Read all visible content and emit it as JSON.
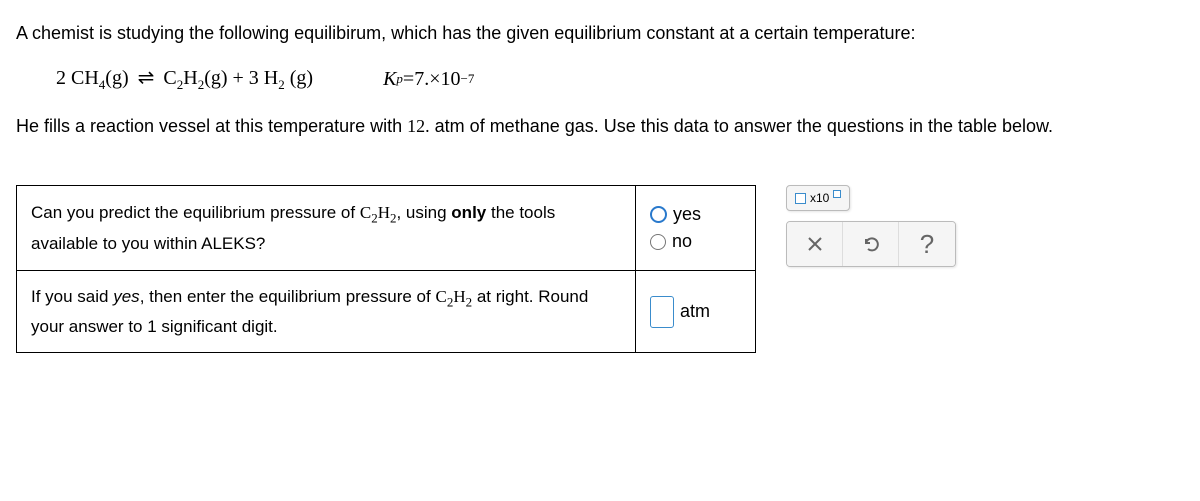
{
  "intro": "A chemist is studying the following equilibirum, which has the given equilibrium constant at a certain temperature:",
  "equation": {
    "lhs_coeff": "2",
    "lhs_species": "CH",
    "lhs_sub": "4",
    "lhs_phase": "(g)",
    "rhs1_species": "C",
    "rhs1_sub1": "2",
    "rhs1_species2": "H",
    "rhs1_sub2": "2",
    "rhs1_phase": "(g)",
    "plus": " + ",
    "rhs2_coeff": "3",
    "rhs2_species": "H",
    "rhs2_sub": "2",
    "rhs2_phase": "(g)"
  },
  "kp": {
    "label": "K",
    "sub": "p",
    "eq": "=",
    "mantissa": "7.",
    "times": " × ",
    "base": "10",
    "exp": "−7"
  },
  "secondary": {
    "pre": "He fills a reaction vessel at this temperature with ",
    "value": "12.",
    "post": " atm of methane gas. Use this data to answer the questions in the table below."
  },
  "q1": {
    "text_pre": "Can you predict the equilibrium pressure of ",
    "species_c": "C",
    "sub1": "2",
    "species_h": "H",
    "sub2": "2",
    "comma": ",",
    "text_mid": " using ",
    "bold": "only",
    "text_post": " the tools available to you within ALEKS?",
    "yes": "yes",
    "no": "no"
  },
  "q2": {
    "text_pre": "If you said ",
    "yes_ital": "yes",
    "text_mid1": ", then enter the equilibrium pressure of ",
    "species_c": "C",
    "sub1": "2",
    "species_h": "H",
    "sub2": "2",
    "text_mid2": " at right. Round your answer to 1 significant digit.",
    "unit": "atm"
  },
  "tools": {
    "sci_label": "x10",
    "help": "?"
  }
}
